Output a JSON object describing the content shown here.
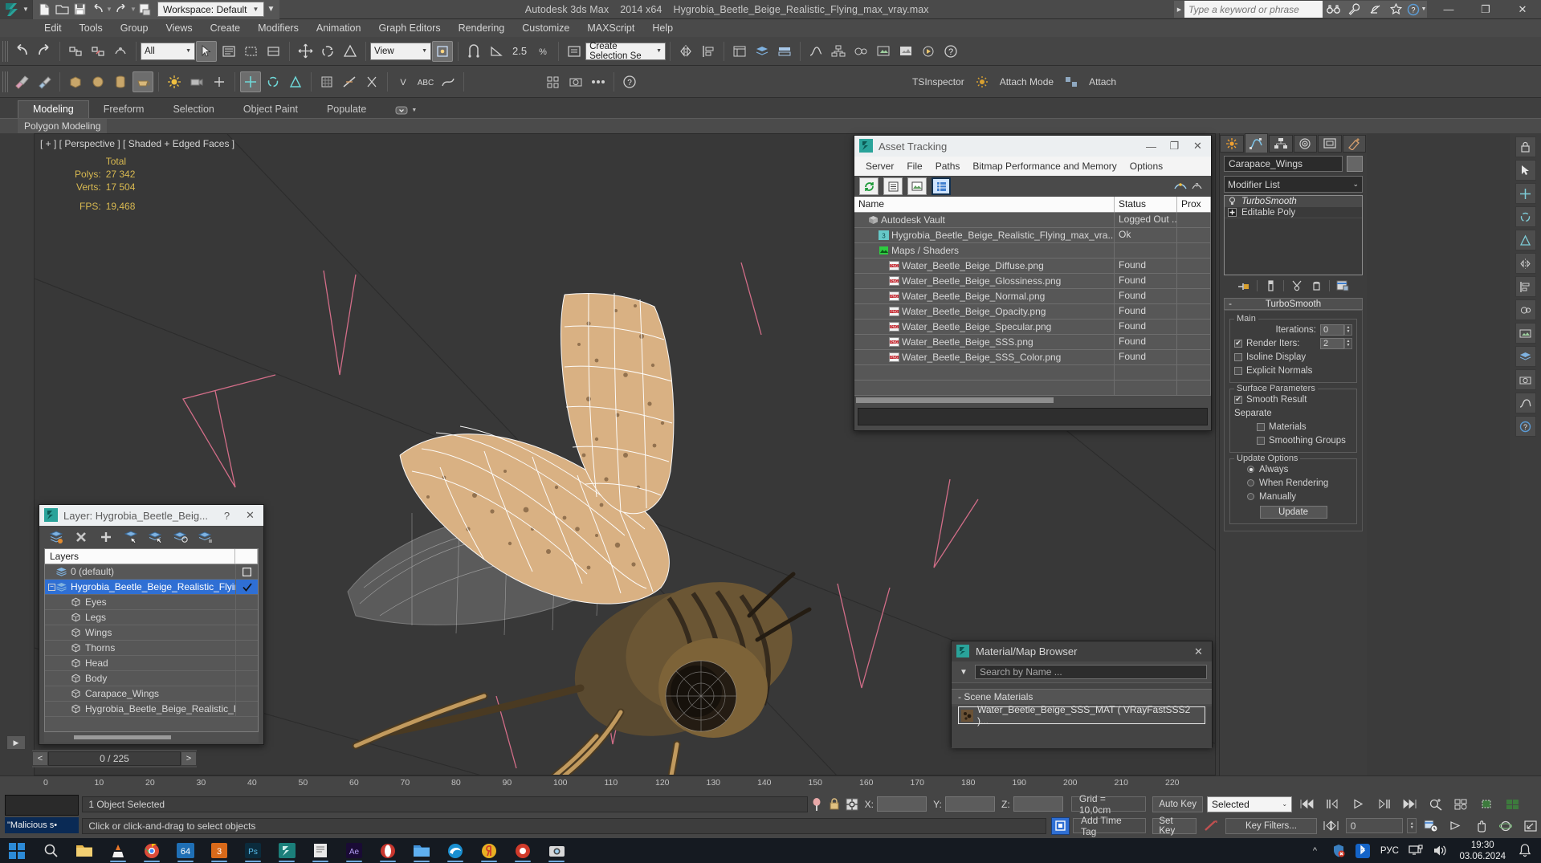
{
  "titlebar": {
    "workspace": "Workspace: Default",
    "app_title": "Autodesk 3ds Max",
    "app_version": "2014 x64",
    "file_name": "Hygrobia_Beetle_Beige_Realistic_Flying_max_vray.max",
    "search_placeholder": "Type a keyword or phrase",
    "minimize": "—",
    "restore": "❐",
    "close": "✕"
  },
  "menu": {
    "items": [
      "Edit",
      "Tools",
      "Group",
      "Views",
      "Create",
      "Modifiers",
      "Animation",
      "Graph Editors",
      "Rendering",
      "Customize",
      "MAXScript",
      "Help"
    ]
  },
  "toolbar": {
    "selection_filter": "All",
    "view_combo": "View",
    "angle_snap_value": "2.5",
    "named_selection_set": "Create Selection Se",
    "tsinspector": "TSInspector",
    "attach_mode": "Attach Mode",
    "attach": "Attach"
  },
  "ribbon": {
    "tabs": [
      "Modeling",
      "Freeform",
      "Selection",
      "Object Paint",
      "Populate"
    ],
    "active_tab": "Modeling",
    "panel_label": "Polygon Modeling"
  },
  "viewport": {
    "label": "[ + ] [ Perspective ] [ Shaded + Edged Faces ]",
    "stats_header": "Total",
    "polys_label": "Polys:",
    "polys_value": "27 342",
    "verts_label": "Verts:",
    "verts_value": "17 504",
    "fps_label": "FPS:",
    "fps_value": "19,468"
  },
  "asset_tracking": {
    "title": "Asset Tracking",
    "menu": [
      "Server",
      "File",
      "Paths",
      "Bitmap Performance and Memory",
      "Options"
    ],
    "columns": [
      "Name",
      "Status",
      "Prox"
    ],
    "rows": [
      {
        "name": "Autodesk Vault",
        "status": "Logged Out ...",
        "indent": 1,
        "icon": "vault-icon"
      },
      {
        "name": "Hygrobia_Beetle_Beige_Realistic_Flying_max_vra...",
        "status": "Ok",
        "indent": 2,
        "icon": "max-file-icon"
      },
      {
        "name": "Maps / Shaders",
        "status": "",
        "indent": 2,
        "icon": "maps-icon"
      },
      {
        "name": "Water_Beetle_Beige_Diffuse.png",
        "status": "Found",
        "indent": 3,
        "icon": "png-icon"
      },
      {
        "name": "Water_Beetle_Beige_Glossiness.png",
        "status": "Found",
        "indent": 3,
        "icon": "png-icon"
      },
      {
        "name": "Water_Beetle_Beige_Normal.png",
        "status": "Found",
        "indent": 3,
        "icon": "png-icon"
      },
      {
        "name": "Water_Beetle_Beige_Opacity.png",
        "status": "Found",
        "indent": 3,
        "icon": "png-icon"
      },
      {
        "name": "Water_Beetle_Beige_Specular.png",
        "status": "Found",
        "indent": 3,
        "icon": "png-icon"
      },
      {
        "name": "Water_Beetle_Beige_SSS.png",
        "status": "Found",
        "indent": 3,
        "icon": "png-icon"
      },
      {
        "name": "Water_Beetle_Beige_SSS_Color.png",
        "status": "Found",
        "indent": 3,
        "icon": "png-icon"
      }
    ],
    "minimize": "—",
    "maximize": "❐",
    "close": "✕"
  },
  "layer_dialog": {
    "title": "Layer: Hygrobia_Beetle_Beig...",
    "help": "?",
    "close": "✕",
    "column_header": "Layers",
    "rows": [
      {
        "label": "0 (default)",
        "indent": 1,
        "type": "layer",
        "selected": false,
        "right": "box"
      },
      {
        "label": "Hygrobia_Beetle_Beige_Realistic_Flying",
        "indent": 1,
        "type": "layer",
        "selected": true,
        "right": "check"
      },
      {
        "label": "Eyes",
        "indent": 2,
        "type": "object",
        "selected": false,
        "right": ""
      },
      {
        "label": "Legs",
        "indent": 2,
        "type": "object",
        "selected": false,
        "right": ""
      },
      {
        "label": "Wings",
        "indent": 2,
        "type": "object",
        "selected": false,
        "right": ""
      },
      {
        "label": "Thorns",
        "indent": 2,
        "type": "object",
        "selected": false,
        "right": ""
      },
      {
        "label": "Head",
        "indent": 2,
        "type": "object",
        "selected": false,
        "right": ""
      },
      {
        "label": "Body",
        "indent": 2,
        "type": "object",
        "selected": false,
        "right": ""
      },
      {
        "label": "Carapace_Wings",
        "indent": 2,
        "type": "object",
        "selected": false,
        "right": ""
      },
      {
        "label": "Hygrobia_Beetle_Beige_Realistic_Flying",
        "indent": 2,
        "type": "object",
        "selected": false,
        "right": ""
      }
    ],
    "nav_prev": "<",
    "nav_counter": "0 / 225",
    "nav_next": ">"
  },
  "material_browser": {
    "title": "Material/Map Browser",
    "close": "✕",
    "search_placeholder": "Search by Name ...",
    "group_label": "- Scene Materials",
    "items": [
      "Water_Beetle_Beige_SSS_MAT  ( VRayFastSSS2 )..."
    ]
  },
  "command_panel": {
    "object_name": "Carapace_Wings",
    "modifier_list": "Modifier List",
    "stack": [
      {
        "label": "TurboSmooth",
        "italic": true
      },
      {
        "label": "Editable Poly",
        "italic": false
      }
    ],
    "rollout": {
      "title": "TurboSmooth",
      "collapse": "-",
      "main_group": "Main",
      "iterations_label": "Iterations:",
      "iterations_value": "0",
      "render_iters_label": "Render Iters:",
      "render_iters_value": "2",
      "render_iters_checked": true,
      "isoline_display": "Isoline Display",
      "isoline_checked": false,
      "explicit_normals": "Explicit Normals",
      "explicit_checked": false,
      "surface_group": "Surface Parameters",
      "smooth_result": "Smooth Result",
      "smooth_checked": true,
      "separate_label": "Separate",
      "materials": "Materials",
      "materials_checked": false,
      "smoothing_groups": "Smoothing Groups",
      "smoothing_checked": false,
      "update_group": "Update Options",
      "always": "Always",
      "when_rendering": "When Rendering",
      "manually": "Manually",
      "selected_update": "Always",
      "update_button": "Update"
    }
  },
  "timeline": {
    "ticks": [
      "0",
      "10",
      "20",
      "30",
      "40",
      "50",
      "60",
      "70",
      "80",
      "90",
      "100",
      "110",
      "120",
      "130",
      "140",
      "150",
      "160",
      "170",
      "180",
      "190",
      "200",
      "210",
      "220"
    ]
  },
  "status_bar": {
    "malicious_text": "\"Malicious s•",
    "selection_text": "1 Object Selected",
    "prompt_text": "Click or click-and-drag to select objects",
    "x_label": "X:",
    "y_label": "Y:",
    "z_label": "Z:",
    "x_value": "",
    "y_value": "",
    "z_value": "",
    "grid_label": "Grid = 10,0cm",
    "add_time_tag": "Add Time Tag",
    "auto_key": "Auto Key",
    "set_key": "Set Key",
    "selected_combo": "Selected",
    "key_filters": "Key Filters...",
    "frame_value": "0"
  },
  "taskbar": {
    "clock_time": "19:30",
    "clock_date": "03.06.2024",
    "language": "РУС",
    "icons": [
      "start-icon",
      "file-explorer-icon",
      "vlc-icon",
      "chrome-icon",
      "soft-64-icon",
      "max-2014-icon",
      "photoshop-icon",
      "max-active-icon",
      "notepad-icon",
      "after-effects-icon",
      "opera-gx-icon",
      "folder-icon",
      "edge-icon",
      "yandex-icon",
      "browser-icon",
      "camera-icon"
    ]
  },
  "colors": {
    "accent_blue": "#2f6fd4",
    "window_bg": "#454545",
    "viewport_bg": "#383838",
    "stat_yellow": "#d8b951",
    "selection_blue": "#2f6fd4"
  }
}
